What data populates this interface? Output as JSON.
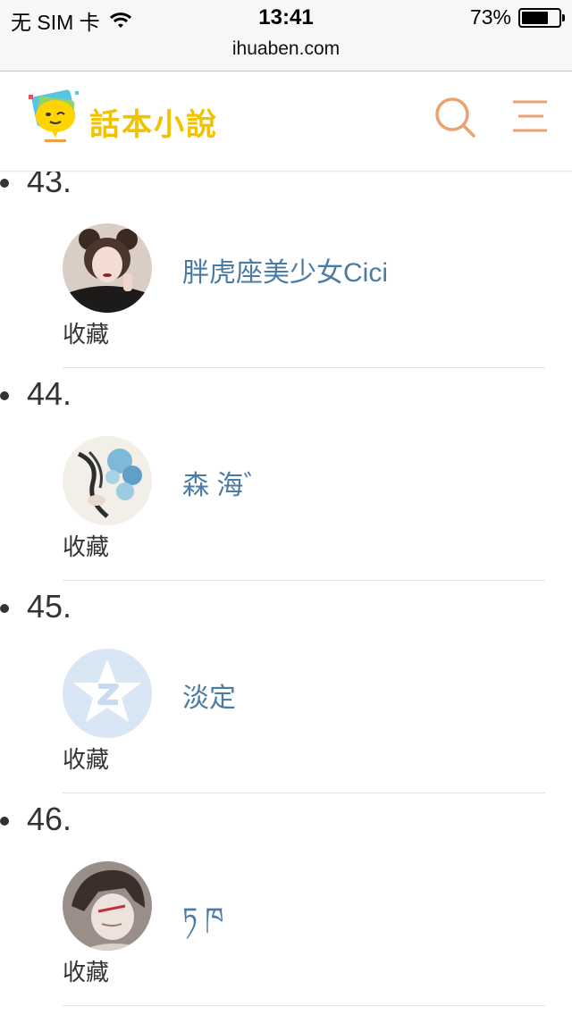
{
  "status_bar": {
    "carrier": "无 SIM 卡",
    "time": "13:41",
    "battery_percent": "73%",
    "battery_level": 0.73
  },
  "browser": {
    "url": "ihuaben.com"
  },
  "header": {
    "logo_text": "話本小說",
    "search_icon": "search-icon",
    "menu_icon": "menu-icon"
  },
  "entries": [
    {
      "number": "43.",
      "username": "胖虎座美少女Cici",
      "action": "收藏",
      "avatar": "avatar-photo-girl"
    },
    {
      "number": "44.",
      "username": "森 海゛",
      "action": "收藏",
      "avatar": "avatar-blue-flowers"
    },
    {
      "number": "45.",
      "username": "淡定",
      "action": "收藏",
      "avatar": "avatar-default-qq"
    },
    {
      "number": "46.",
      "username": "ཏ ཁ",
      "action": "收藏",
      "avatar": "avatar-anime-boy"
    }
  ]
}
